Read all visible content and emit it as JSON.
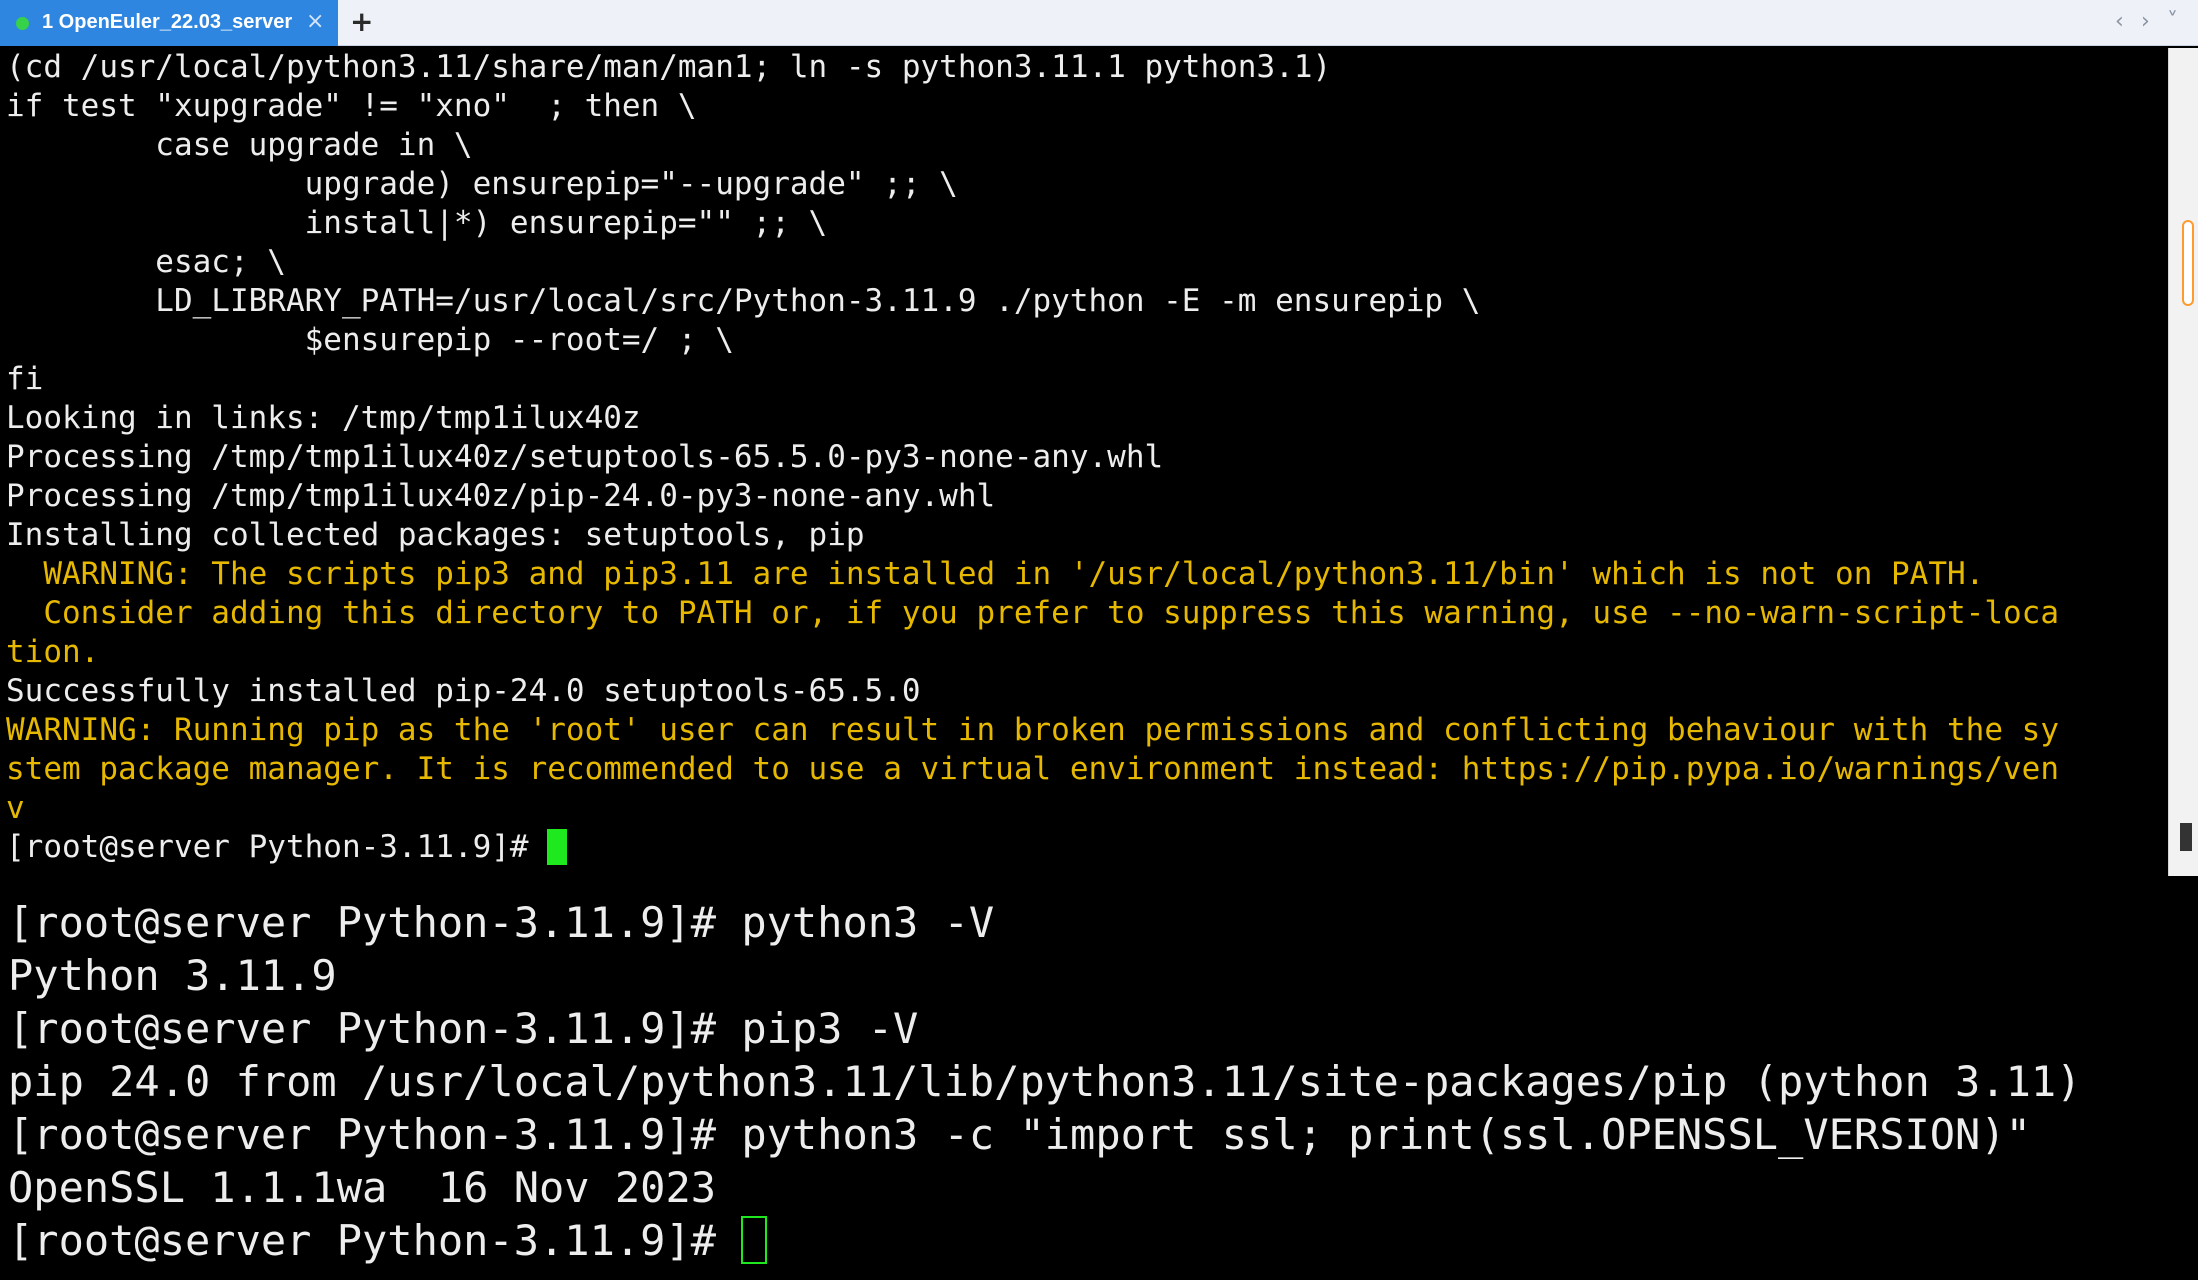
{
  "tabbar": {
    "tab": {
      "label": "1 OpenEuler_22.03_server",
      "status_color": "#35d24a",
      "close_glyph": "×"
    },
    "add_glyph": "+",
    "prev_glyph": "‹",
    "next_glyph": "›",
    "menu_glyph": "˅"
  },
  "terminal": {
    "lines": [
      {
        "text": "(cd /usr/local/python3.11/share/man/man1; ln -s python3.11.1 python3.1)",
        "type": "normal"
      },
      {
        "text": "if test \"xupgrade\" != \"xno\"  ; then \\",
        "type": "normal"
      },
      {
        "text": "        case upgrade in \\",
        "type": "normal"
      },
      {
        "text": "                upgrade) ensurepip=\"--upgrade\" ;; \\",
        "type": "normal"
      },
      {
        "text": "                install|*) ensurepip=\"\" ;; \\",
        "type": "normal"
      },
      {
        "text": "        esac; \\",
        "type": "normal"
      },
      {
        "text": "        LD_LIBRARY_PATH=/usr/local/src/Python-3.11.9 ./python -E -m ensurepip \\",
        "type": "normal"
      },
      {
        "text": "                $ensurepip --root=/ ; \\",
        "type": "normal"
      },
      {
        "text": "fi",
        "type": "normal"
      },
      {
        "text": "Looking in links: /tmp/tmp1ilux40z",
        "type": "normal"
      },
      {
        "text": "Processing /tmp/tmp1ilux40z/setuptools-65.5.0-py3-none-any.whl",
        "type": "normal"
      },
      {
        "text": "Processing /tmp/tmp1ilux40z/pip-24.0-py3-none-any.whl",
        "type": "normal"
      },
      {
        "text": "Installing collected packages: setuptools, pip",
        "type": "normal"
      },
      {
        "text": "  WARNING: The scripts pip3 and pip3.11 are installed in '/usr/local/python3.11/bin' which is not on PATH.",
        "type": "warn"
      },
      {
        "text": "  Consider adding this directory to PATH or, if you prefer to suppress this warning, use --no-warn-script-loca",
        "type": "warn"
      },
      {
        "text": "tion.",
        "type": "warn"
      },
      {
        "text": "Successfully installed pip-24.0 setuptools-65.5.0",
        "type": "normal"
      },
      {
        "text": "WARNING: Running pip as the 'root' user can result in broken permissions and conflicting behaviour with the sy",
        "type": "warn"
      },
      {
        "text": "stem package manager. It is recommended to use a virtual environment instead: https://pip.pypa.io/warnings/ven",
        "type": "warn"
      },
      {
        "text": "v",
        "type": "warn"
      }
    ],
    "prompt": "[root@server Python-3.11.9]# ",
    "cursor_color": "#1ee81e"
  },
  "overlay": {
    "lines": [
      {
        "prompt": "[root@server Python-3.11.9]# ",
        "command": "python3 -V"
      },
      {
        "output": "Python 3.11.9"
      },
      {
        "prompt": "[root@server Python-3.11.9]# ",
        "command": "pip3 -V"
      },
      {
        "output": "pip 24.0 from /usr/local/python3.11/lib/python3.11/site-packages/pip (python 3.11)"
      },
      {
        "prompt": "[root@server Python-3.11.9]# ",
        "command": "python3 -c \"import ssl; print(ssl.OPENSSL_VERSION)\""
      },
      {
        "output": "OpenSSL 1.1.1wa  16 Nov 2023"
      }
    ],
    "final_prompt": "[root@server Python-3.11.9]# "
  },
  "colors": {
    "terminal_bg": "#000000",
    "text": "#ededed",
    "warning": "#e6b800",
    "tab_active": "#2e86e0",
    "scroll_thumb_border": "#ff9a2e"
  }
}
